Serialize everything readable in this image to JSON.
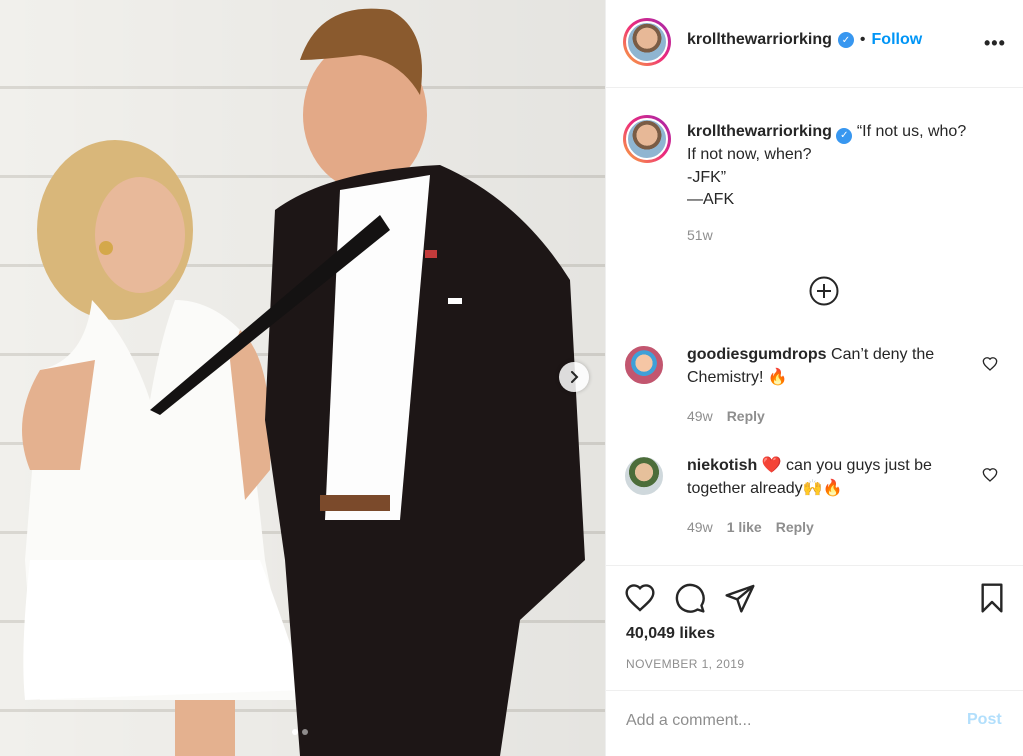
{
  "post": {
    "author": "krollthewarriorking",
    "follow_label": "Follow",
    "more_label": "•••",
    "bullet": "•",
    "image_alt": "Post photo",
    "caption": "“If not us, who?\nIf not now, when?\n-JFK”\n—AFK",
    "caption_age": "51w",
    "carousel_index": 1,
    "carousel_count": 2
  },
  "comments": [
    {
      "username": "goodiesgumdrops",
      "text": "Can’t deny the Chemistry! 🔥",
      "age": "49w",
      "likes": "",
      "reply_label": "Reply"
    },
    {
      "username": "niekotish",
      "text": "❤️ can you guys just be together already🙌🔥",
      "age": "49w",
      "likes": "1 like",
      "reply_label": "Reply"
    }
  ],
  "actions": {
    "likes": "40,049 likes",
    "date": "NOVEMBER 1, 2019"
  },
  "comment_box": {
    "placeholder": "Add a comment...",
    "post_label": "Post"
  },
  "icons": {
    "next": "chevron-right-icon",
    "load_more": "plus-circle-icon",
    "like": "heart-icon",
    "comment": "comment-icon",
    "share": "paper-plane-icon",
    "save": "bookmark-icon",
    "verified": "verified-badge-icon"
  },
  "colors": {
    "accent": "#0095f6",
    "verified": "#3897f0",
    "muted": "#8e8e8e",
    "text": "#262626"
  }
}
